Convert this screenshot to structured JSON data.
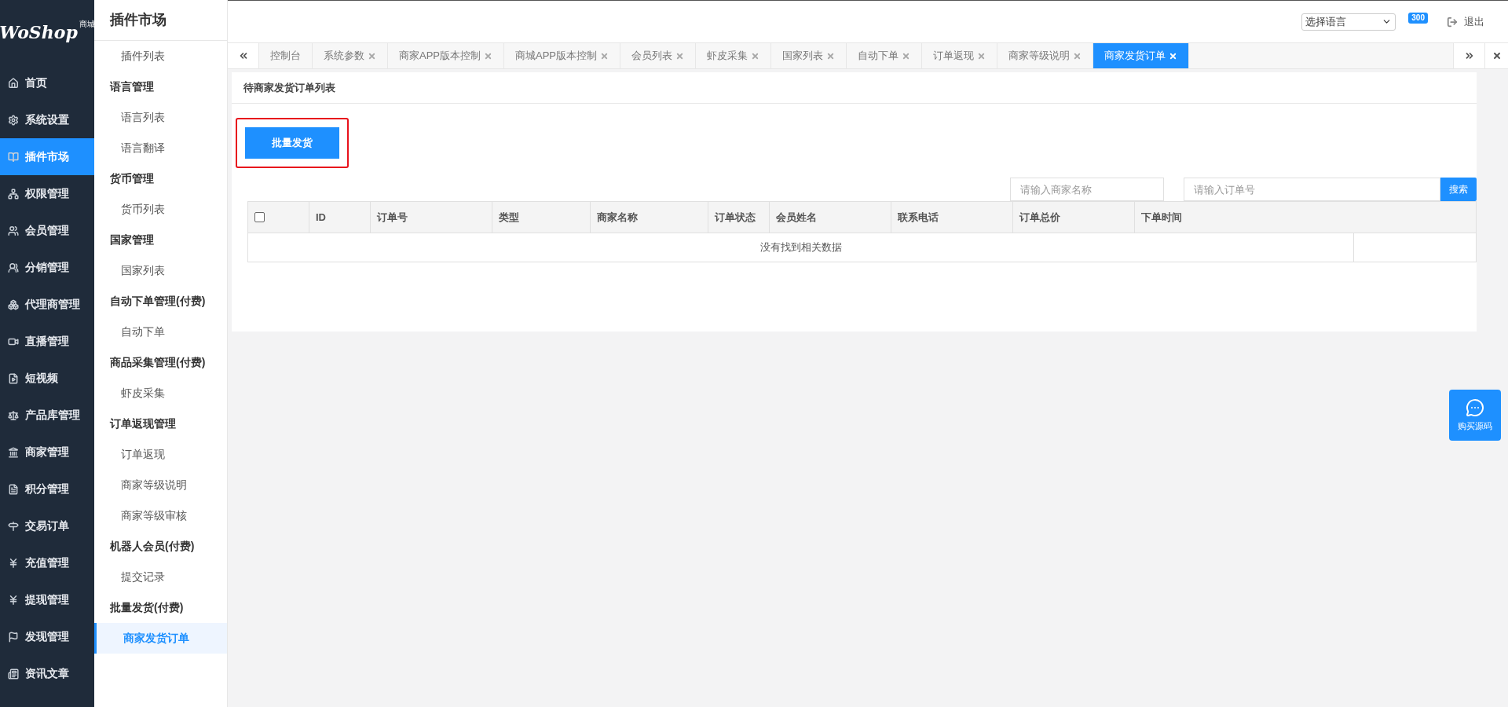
{
  "logo": {
    "text": "WoShop",
    "tag": "商城"
  },
  "nav": [
    {
      "label": "首页",
      "selected": false
    },
    {
      "label": "系统设置",
      "selected": false
    },
    {
      "label": "插件市场",
      "selected": true
    },
    {
      "label": "权限管理",
      "selected": false
    },
    {
      "label": "会员管理",
      "selected": false
    },
    {
      "label": "分销管理",
      "selected": false
    },
    {
      "label": "代理商管理",
      "selected": false
    },
    {
      "label": "直播管理",
      "selected": false
    },
    {
      "label": "短视频",
      "selected": false
    },
    {
      "label": "产品库管理",
      "selected": false
    },
    {
      "label": "商家管理",
      "selected": false
    },
    {
      "label": "积分管理",
      "selected": false
    },
    {
      "label": "交易订单",
      "selected": false
    },
    {
      "label": "充值管理",
      "selected": false
    },
    {
      "label": "提现管理",
      "selected": false
    },
    {
      "label": "发现管理",
      "selected": false
    },
    {
      "label": "资讯文章",
      "selected": false
    }
  ],
  "submenu": {
    "title": "插件市场",
    "items": [
      {
        "kind": "link",
        "label": "插件列表",
        "selected": false
      },
      {
        "kind": "group",
        "label": "语言管理"
      },
      {
        "kind": "link",
        "label": "语言列表",
        "selected": false
      },
      {
        "kind": "link",
        "label": "语言翻译",
        "selected": false
      },
      {
        "kind": "group",
        "label": "货币管理"
      },
      {
        "kind": "link",
        "label": "货币列表",
        "selected": false
      },
      {
        "kind": "group",
        "label": "国家管理"
      },
      {
        "kind": "link",
        "label": "国家列表",
        "selected": false
      },
      {
        "kind": "group",
        "label": "自动下单管理(付费)"
      },
      {
        "kind": "link",
        "label": "自动下单",
        "selected": false
      },
      {
        "kind": "group",
        "label": "商品采集管理(付费)"
      },
      {
        "kind": "link",
        "label": "虾皮采集",
        "selected": false
      },
      {
        "kind": "group",
        "label": "订单返现管理"
      },
      {
        "kind": "link",
        "label": "订单返现",
        "selected": false
      },
      {
        "kind": "link",
        "label": "商家等级说明",
        "selected": false
      },
      {
        "kind": "link",
        "label": "商家等级审核",
        "selected": false
      },
      {
        "kind": "group",
        "label": "机器人会员(付费)"
      },
      {
        "kind": "link",
        "label": "提交记录",
        "selected": false
      },
      {
        "kind": "group",
        "label": "批量发货(付费)"
      },
      {
        "kind": "link",
        "label": "商家发货订单",
        "selected": true
      }
    ]
  },
  "header": {
    "language_select": "选择语言",
    "badge": "300",
    "logout": "退出"
  },
  "tabs": [
    {
      "label": "控制台",
      "closable": false,
      "selected": false
    },
    {
      "label": "系统参数",
      "closable": true,
      "selected": false
    },
    {
      "label": "商家APP版本控制",
      "closable": true,
      "selected": false
    },
    {
      "label": "商城APP版本控制",
      "closable": true,
      "selected": false
    },
    {
      "label": "会员列表",
      "closable": true,
      "selected": false
    },
    {
      "label": "虾皮采集",
      "closable": true,
      "selected": false
    },
    {
      "label": "国家列表",
      "closable": true,
      "selected": false
    },
    {
      "label": "自动下单",
      "closable": true,
      "selected": false
    },
    {
      "label": "订单返现",
      "closable": true,
      "selected": false
    },
    {
      "label": "商家等级说明",
      "closable": true,
      "selected": false
    },
    {
      "label": "商家发货订单",
      "closable": true,
      "selected": true
    }
  ],
  "panel": {
    "title": "待商家发货订单列表",
    "batch_button": "批量发货",
    "highlighted": true,
    "merchant_field": {
      "placeholder": "请输入商家名称"
    },
    "order_field": {
      "placeholder": "请输入订单号"
    },
    "search_button": "搜索",
    "table": {
      "select_all": false,
      "columns": [
        "ID",
        "订单号",
        "类型",
        "商家名称",
        "订单状态",
        "会员姓名",
        "联系电话",
        "订单总价",
        "下单时间"
      ],
      "empty": "没有找到相关数据"
    }
  },
  "float_button": "购买源码"
}
